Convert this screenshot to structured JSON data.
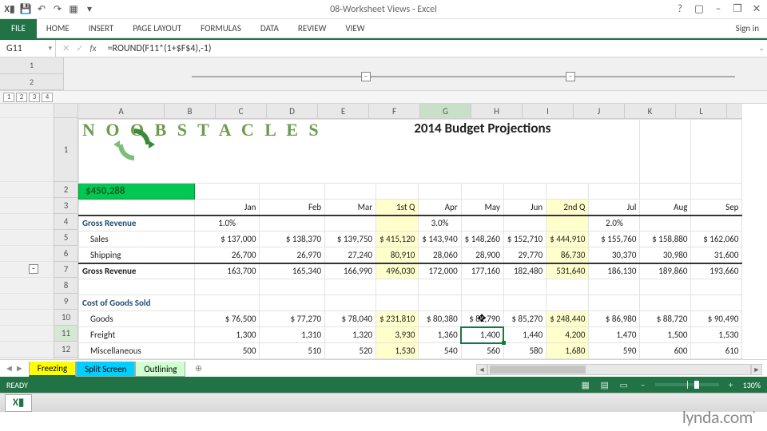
{
  "window": {
    "title": "08-Worksheet Views - Excel",
    "signin": "Sign in"
  },
  "qat": {
    "save": "💾",
    "undo": "↶",
    "redo": "↷",
    "touch": "▦",
    "dd": "▾"
  },
  "tabs": {
    "file": "FILE",
    "home": "HOME",
    "insert": "INSERT",
    "page": "PAGE LAYOUT",
    "formulas": "FORMULAS",
    "data": "DATA",
    "review": "REVIEW",
    "view": "VIEW"
  },
  "winctl": {
    "help": "?",
    "opts": "▢",
    "min": "–",
    "max": "❐",
    "close": "✕"
  },
  "namebox": "G11",
  "formula": "=ROUND(F11*(1+$F$4),-1)",
  "levels": [
    "1",
    "2",
    "3",
    "4"
  ],
  "outline_rows": [
    "1",
    "2"
  ],
  "columns": [
    "A",
    "B",
    "C",
    "D",
    "E",
    "F",
    "G",
    "H",
    "I",
    "J",
    "K",
    "L"
  ],
  "row_nums": [
    "1",
    "2",
    "3",
    "4",
    "5",
    "6",
    "7",
    "8",
    "9",
    "10",
    "11",
    "12"
  ],
  "title_logo": "N O  O B S T A C L E S",
  "title_main": "2014 Budget Projections",
  "big_value_sym": "$",
  "big_value": "450,288",
  "months": {
    "b": "Jan",
    "c": "Feb",
    "d": "Mar",
    "e": "1st Q",
    "f": "Apr",
    "g": "May",
    "h": "Jun",
    "i": "2nd Q",
    "j": "Jul",
    "k": "Aug",
    "l": "Sep"
  },
  "sections": {
    "gross": "Gross Revenue",
    "cogs": "Cost of Goods Sold"
  },
  "rows": {
    "pct4": {
      "b": "1.0%",
      "f": "3.0%",
      "j": "2.0%"
    },
    "sales": {
      "a": "Sales",
      "b": "$ 137,000",
      "c": "$ 138,370",
      "d": "$ 139,750",
      "e": "$ 415,120",
      "f": "$ 143,940",
      "g": "$ 148,260",
      "h": "$ 152,710",
      "i": "$ 444,910",
      "j": "$ 155,760",
      "k": "$ 158,880",
      "l": "$ 162,060"
    },
    "shipping": {
      "a": "Shipping",
      "b": "26,700",
      "c": "26,970",
      "d": "27,240",
      "e": "80,910",
      "f": "28,060",
      "g": "28,900",
      "h": "29,770",
      "i": "86,730",
      "j": "30,370",
      "k": "30,980",
      "l": "31,600"
    },
    "grossrev": {
      "a": "Gross Revenue",
      "b": "163,700",
      "c": "165,340",
      "d": "166,990",
      "e": "496,030",
      "f": "172,000",
      "g": "177,160",
      "h": "182,480",
      "i": "531,640",
      "j": "186,130",
      "k": "189,860",
      "l": "193,660"
    },
    "goods": {
      "a": "Goods",
      "b": "$  76,500",
      "c": "$  77,270",
      "d": "$  78,040",
      "e": "$ 231,810",
      "f": "$  80,380",
      "g": "$  82,790",
      "h": "$  85,270",
      "i": "$ 248,440",
      "j": "$  86,980",
      "k": "$  88,720",
      "l": "$  90,490"
    },
    "freight": {
      "a": "Freight",
      "b": "1,300",
      "c": "1,310",
      "d": "1,320",
      "e": "3,930",
      "f": "1,360",
      "g": "1,400",
      "h": "1,440",
      "i": "4,200",
      "j": "1,470",
      "k": "1,500",
      "l": "1,530"
    },
    "misc": {
      "a": "Miscellaneous",
      "b": "500",
      "c": "510",
      "d": "520",
      "e": "1,530",
      "f": "540",
      "g": "560",
      "h": "580",
      "i": "1,680",
      "j": "590",
      "k": "600",
      "l": "610"
    }
  },
  "sheet_tabs": {
    "freezing": "Freezing",
    "split": "Split Screen",
    "outlining": "Outlining",
    "new": "⊕"
  },
  "status": {
    "ready": "READY",
    "zoom": "130%"
  },
  "watermark": "lynda.com",
  "cursor_glyph": "✥"
}
